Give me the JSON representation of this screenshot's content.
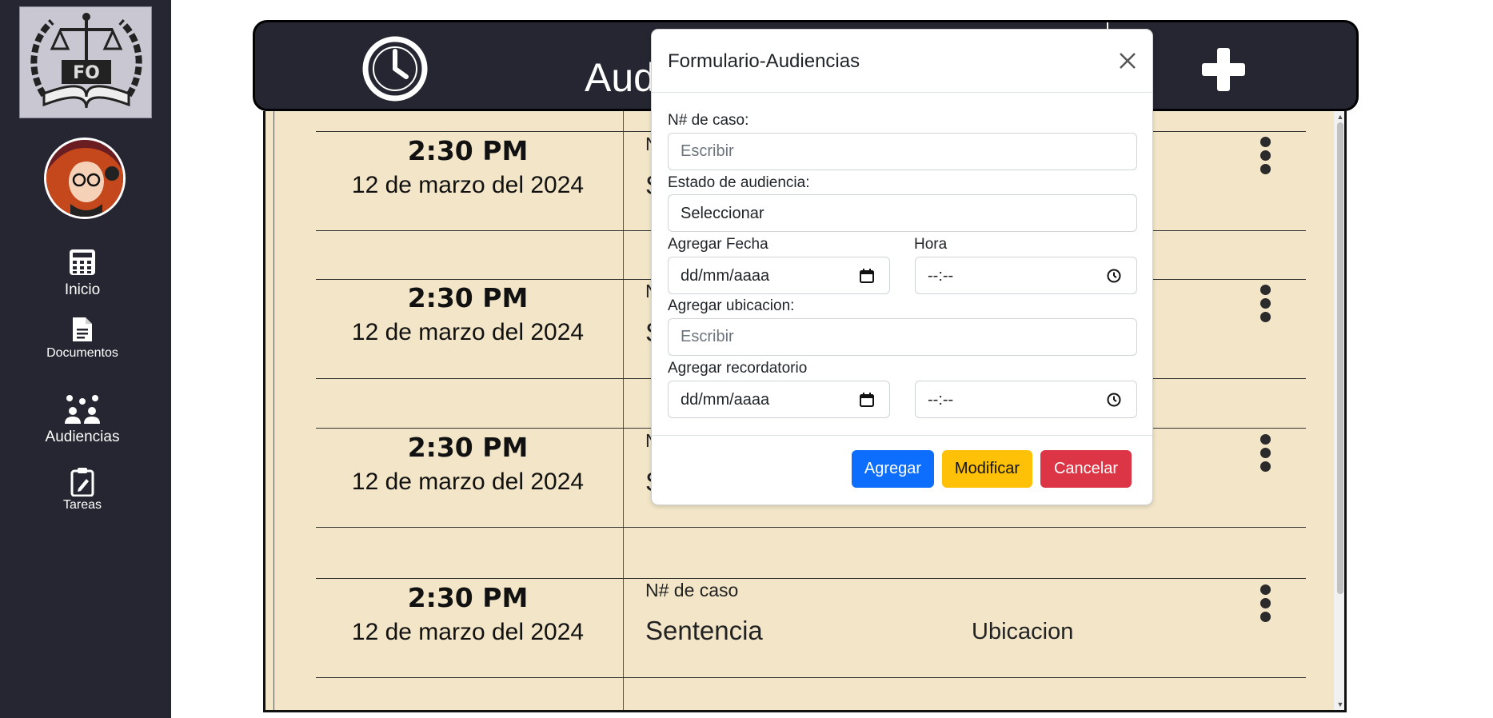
{
  "sidebar": {
    "items": [
      {
        "label": "Inicio",
        "icon": "calculator-icon"
      },
      {
        "label": "Documentos",
        "icon": "document-icon"
      },
      {
        "label": "Audiencias",
        "icon": "people-group-icon"
      },
      {
        "label": "Tareas",
        "icon": "clipboard-icon"
      }
    ]
  },
  "header": {
    "title": "Aud",
    "clock_icon": "clock-icon",
    "add_icon": "plus-icon"
  },
  "rows": [
    {
      "time": "2:30 PM",
      "date": "12 de marzo del 2024",
      "case": "N",
      "status": "S",
      "location": ""
    },
    {
      "time": "2:30 PM",
      "date": "12 de marzo del 2024",
      "case": "N",
      "status": "S",
      "location": ""
    },
    {
      "time": "2:30 PM",
      "date": "12 de marzo del 2024",
      "case": "N",
      "status": "S",
      "location": ""
    },
    {
      "time": "2:30 PM",
      "date": "12 de marzo del 2024",
      "case": "N# de caso",
      "status": "Sentencia",
      "location": "Ubicacion"
    }
  ],
  "modal": {
    "title": "Formulario-Audiencias",
    "case_label": "N# de caso:",
    "case_placeholder": "Escribir",
    "status_label": "Estado de audiencia:",
    "status_value": "Seleccionar",
    "date_label": "Agregar Fecha",
    "date_placeholder": "dd/mm/aaaa",
    "time_label": "Hora",
    "time_placeholder": "--:--",
    "location_label": "Agregar ubicacion:",
    "location_placeholder": "Escribir",
    "reminder_label": "Agregar recordatorio",
    "reminder_date_placeholder": "dd/mm/aaaa",
    "reminder_time_placeholder": "--:--",
    "buttons": {
      "add": "Agregar",
      "modify": "Modificar",
      "cancel": "Cancelar"
    }
  },
  "colors": {
    "sidebar_bg": "#252631",
    "list_bg": "#f3e6c8",
    "btn_add": "#0d6efd",
    "btn_modify": "#ffc107",
    "btn_cancel": "#dc3545"
  }
}
